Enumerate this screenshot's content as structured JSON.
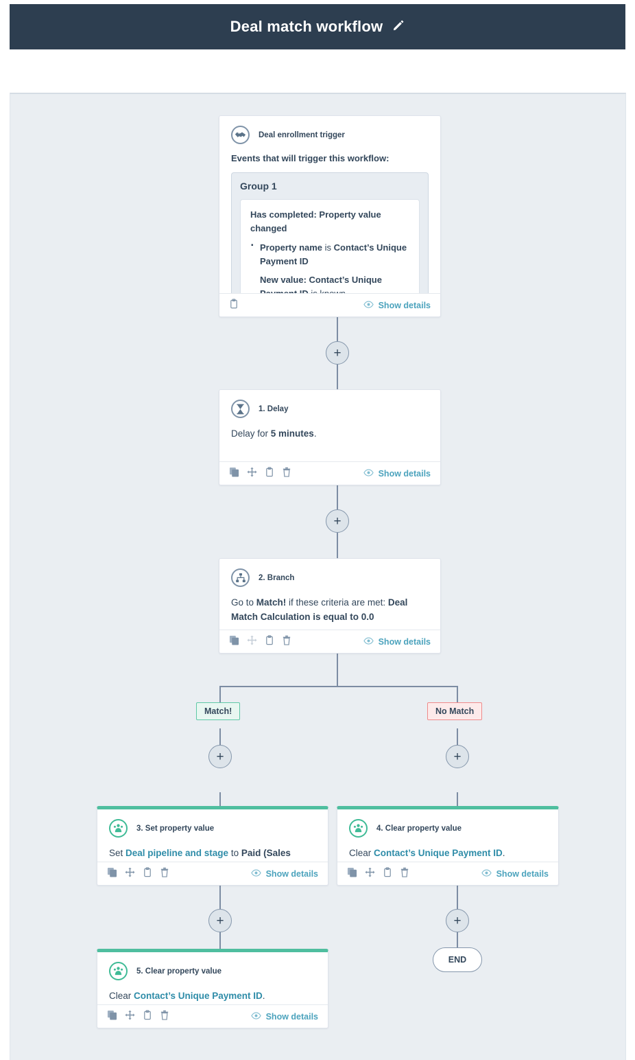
{
  "header": {
    "title": "Deal match workflow",
    "edit_icon": "pencil-icon",
    "background": "#2d3e50"
  },
  "canvas": {
    "background": "#eaeef2"
  },
  "common": {
    "show_details_label": "Show details",
    "eye_icon": "eye-icon",
    "plus_label": "+",
    "icons": {
      "duplicate": "duplicate-icon",
      "move": "move-icon",
      "copy": "clipboard-icon",
      "delete": "trash-icon"
    }
  },
  "trigger": {
    "icon": "handshake-icon",
    "title": "Deal enrollment trigger",
    "lead": "Events that will trigger this workflow:",
    "group": {
      "title": "Group 1",
      "condition_head": "Has completed: Property value changed",
      "criteria": [
        {
          "bold_prefix": "Property name",
          "middle": " is ",
          "bold_suffix": "Contact’s Unique Payment ID",
          "bulleted": true
        },
        {
          "bold_prefix": "New value: Contact’s Unique Payment ID",
          "middle": " is known",
          "bold_suffix": "",
          "bulleted": false
        }
      ]
    },
    "footer": {
      "copy_icon": "clipboard-icon",
      "show_details": "Show details"
    }
  },
  "steps": [
    {
      "id": "step-1",
      "icon": "hourglass-icon",
      "icon_color": "#7f93a8",
      "title": "1. Delay",
      "text_parts": [
        {
          "t": "Delay for ",
          "style": "normal"
        },
        {
          "t": "5 minutes",
          "style": "bold"
        },
        {
          "t": ".",
          "style": "normal"
        }
      ],
      "green_top": false
    },
    {
      "id": "step-2",
      "icon": "branch-icon",
      "icon_color": "#7f93a8",
      "title": "2. Branch",
      "text_parts": [
        {
          "t": "Go to ",
          "style": "normal"
        },
        {
          "t": "Match!",
          "style": "bold"
        },
        {
          "t": " if these criteria are met: ",
          "style": "normal"
        },
        {
          "t": "Deal Match Calculation is equal to 0.0",
          "style": "bold"
        }
      ],
      "green_top": false
    },
    {
      "id": "step-3",
      "icon": "people-icon",
      "icon_color": "#3fbb96",
      "title": "3. Set property value",
      "text_parts": [
        {
          "t": "Set ",
          "style": "normal"
        },
        {
          "t": "Deal pipeline and stage",
          "style": "link"
        },
        {
          "t": " to ",
          "style": "normal"
        },
        {
          "t": "Paid (Sales Pipeline)",
          "style": "bold"
        },
        {
          "t": ".",
          "style": "normal"
        }
      ],
      "green_top": true
    },
    {
      "id": "step-4",
      "icon": "people-icon",
      "icon_color": "#3fbb96",
      "title": "4. Clear property value",
      "text_parts": [
        {
          "t": "Clear ",
          "style": "normal"
        },
        {
          "t": "Contact’s Unique Payment ID",
          "style": "link"
        },
        {
          "t": ".",
          "style": "normal"
        }
      ],
      "green_top": true
    },
    {
      "id": "step-5",
      "icon": "people-icon",
      "icon_color": "#3fbb96",
      "title": "5. Clear property value",
      "text_parts": [
        {
          "t": "Clear ",
          "style": "normal"
        },
        {
          "t": "Contact’s Unique Payment ID",
          "style": "link"
        },
        {
          "t": ".",
          "style": "normal"
        }
      ],
      "green_top": true
    }
  ],
  "branch_labels": {
    "match": "Match!",
    "no_match": "No Match",
    "match_border": "#5ec8a6",
    "no_match_border": "#ef8a8a"
  },
  "end_node": {
    "label": "END"
  }
}
